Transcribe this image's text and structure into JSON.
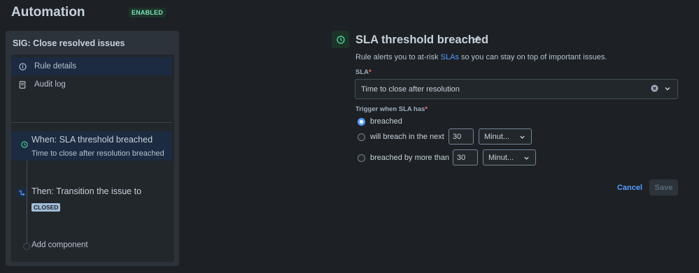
{
  "header": {
    "title": "Automation",
    "status_badge": "ENABLED"
  },
  "rule": {
    "name": "SIG: Close resolved issues",
    "nav": [
      {
        "label": "Rule details",
        "icon": "info-icon",
        "selected": true
      },
      {
        "label": "Audit log",
        "icon": "document-icon",
        "selected": false
      }
    ],
    "steps": {
      "when_title": "When: SLA threshold breached",
      "when_subtitle": "Time to close after resolution breached",
      "then_title": "Then: Transition the issue to",
      "then_status": "CLOSED",
      "add_component": "Add component"
    }
  },
  "config": {
    "title": "SLA threshold breached",
    "description_prefix": "Rule alerts you to at-risk ",
    "description_link": "SLAs",
    "description_suffix": " so you can stay on top of important issues.",
    "sla_label": "SLA",
    "sla_required_mark": "*",
    "sla_value": "Time to close after resolution",
    "trigger_label": "Trigger when SLA has",
    "trigger_required_mark": "*",
    "options": [
      {
        "label": "breached",
        "checked": true
      },
      {
        "label": "will breach in the next",
        "checked": false,
        "amount": "30",
        "unit": "Minut..."
      },
      {
        "label": "breached by more than",
        "checked": false,
        "amount": "30",
        "unit": "Minut..."
      }
    ],
    "cancel_label": "Cancel",
    "save_label": "Save"
  },
  "colors": {
    "background": "#1d2125",
    "accent": "#579dff",
    "success": "#7ee2b8",
    "required": "#f87168"
  }
}
